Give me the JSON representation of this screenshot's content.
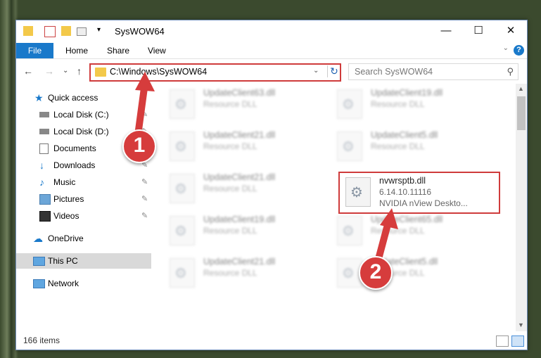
{
  "window": {
    "title": "SysWOW64",
    "minimize": "—",
    "maximize": "☐",
    "close": "✕"
  },
  "ribbon": {
    "file": "File",
    "home": "Home",
    "share": "Share",
    "view": "View",
    "help": "?"
  },
  "address": {
    "path": "C:\\Windows\\SysWOW64",
    "search_placeholder": "Search SysWOW64"
  },
  "nav": {
    "items": [
      {
        "label": "Quick access"
      },
      {
        "label": "Local Disk (C:)"
      },
      {
        "label": "Local Disk (D:)"
      },
      {
        "label": "Documents"
      },
      {
        "label": "Downloads"
      },
      {
        "label": "Music"
      },
      {
        "label": "Pictures"
      },
      {
        "label": "Videos"
      },
      {
        "label": "OneDrive"
      },
      {
        "label": "This PC"
      },
      {
        "label": "Network"
      }
    ]
  },
  "files": {
    "f1": {
      "name": "UpdateClient63.dll",
      "type": "Resource DLL"
    },
    "f2": {
      "name": "UpdateClient19.dll",
      "type": "Resource DLL"
    },
    "f3": {
      "name": "UpdateClient21.dll",
      "type": "Resource DLL"
    },
    "f4": {
      "name": "UpdateClient5.dll",
      "type": "Resource DLL"
    },
    "f5": {
      "name": "UpdateClient21.dll",
      "type": "Resource DLL"
    },
    "f7": {
      "name": "UpdateClient19.dll",
      "type": "Resource DLL"
    },
    "f8": {
      "name": "UpdateClient65.dll",
      "type": "Resource DLL"
    },
    "f9": {
      "name": "UpdateClient21.dll",
      "type": "Resource DLL"
    },
    "f10": {
      "name": "UpdateClient5.dll",
      "type": "Resource DLL"
    }
  },
  "highlight_file": {
    "name": "nvwrsptb.dll",
    "version": "6.14.10.11116",
    "description": "NVIDIA nView Deskto..."
  },
  "status": {
    "count": "166 items"
  },
  "badges": {
    "one": "1",
    "two": "2"
  }
}
